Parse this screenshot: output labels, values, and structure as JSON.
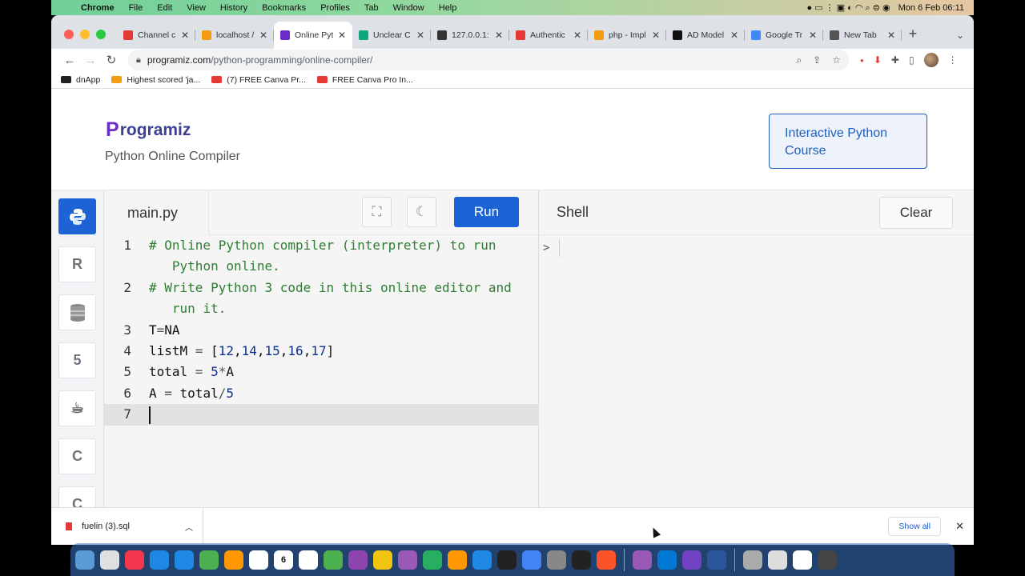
{
  "menubar": {
    "app": "Chrome",
    "items": [
      "File",
      "Edit",
      "View",
      "History",
      "Bookmarks",
      "Profiles",
      "Tab",
      "Window",
      "Help"
    ],
    "datetime": "Mon 6 Feb  06:11"
  },
  "tabs": [
    {
      "label": "Channel c",
      "color": "#e53935"
    },
    {
      "label": "localhost /",
      "color": "#f39c12"
    },
    {
      "label": "Online Pyt",
      "color": "#6c2dc7",
      "active": true
    },
    {
      "label": "Unclear C",
      "color": "#10a37f"
    },
    {
      "label": "127.0.0.1:",
      "color": "#333333"
    },
    {
      "label": "Authentic",
      "color": "#e53935"
    },
    {
      "label": "php - Impl",
      "color": "#f39c12"
    },
    {
      "label": "AD Model",
      "color": "#111111"
    },
    {
      "label": "Google Tr",
      "color": "#4285f4"
    },
    {
      "label": "New Tab",
      "color": "#555555"
    }
  ],
  "address": {
    "host": "programiz.com",
    "path": "/python-programming/online-compiler/"
  },
  "bookmarks": [
    {
      "label": "dnApp",
      "color": "#222222"
    },
    {
      "label": "Highest scored 'ja...",
      "color": "#f39c12"
    },
    {
      "label": "(7) FREE Canva Pr...",
      "color": "#e53935"
    },
    {
      "label": "FREE Canva Pro In...",
      "color": "#e53935"
    }
  ],
  "header": {
    "logo": "rogramiz",
    "logo_p": "P",
    "subtitle": "Python Online Compiler",
    "course_button": "Interactive Python Course"
  },
  "sidebar": [
    "python-icon",
    "r-icon",
    "sql-icon",
    "html5-icon",
    "java-icon",
    "c-icon",
    "cpp-icon"
  ],
  "editor": {
    "filename": "main.py",
    "run_label": "Run",
    "lines": [
      {
        "num": "1",
        "parts": [
          {
            "t": "# Online Python compiler (interpreter) to run\n   Python online.",
            "c": "c-com"
          }
        ]
      },
      {
        "num": "2",
        "parts": [
          {
            "t": "# Write Python 3 code in this online editor and\n   run it.",
            "c": "c-com"
          }
        ]
      },
      {
        "num": "3",
        "parts": [
          {
            "t": "T"
          },
          {
            "t": "=",
            "c": "c-op"
          },
          {
            "t": "NA"
          }
        ]
      },
      {
        "num": "4",
        "parts": [
          {
            "t": "listM "
          },
          {
            "t": "=",
            "c": "c-op"
          },
          {
            "t": " ["
          },
          {
            "t": "12",
            "c": "c-num"
          },
          {
            "t": ","
          },
          {
            "t": "14",
            "c": "c-num"
          },
          {
            "t": ","
          },
          {
            "t": "15",
            "c": "c-num"
          },
          {
            "t": ","
          },
          {
            "t": "16",
            "c": "c-num"
          },
          {
            "t": ","
          },
          {
            "t": "17",
            "c": "c-num"
          },
          {
            "t": "]"
          }
        ]
      },
      {
        "num": "5",
        "parts": [
          {
            "t": "total "
          },
          {
            "t": "=",
            "c": "c-op"
          },
          {
            "t": " "
          },
          {
            "t": "5",
            "c": "c-num"
          },
          {
            "t": "*",
            "c": "c-op"
          },
          {
            "t": "A"
          }
        ]
      },
      {
        "num": "6",
        "parts": [
          {
            "t": "A "
          },
          {
            "t": "=",
            "c": "c-op"
          },
          {
            "t": " total"
          },
          {
            "t": "/",
            "c": "c-op"
          },
          {
            "t": "5",
            "c": "c-num"
          }
        ]
      },
      {
        "num": "7",
        "parts": [],
        "active": true
      }
    ]
  },
  "shell": {
    "title": "Shell",
    "clear_label": "Clear",
    "prompt": ">"
  },
  "download": {
    "file": "fuelin (3).sql",
    "show_all": "Show all"
  },
  "dock": {
    "colors": [
      "#5b9bd5",
      "#e0e0e0",
      "#f4364c",
      "#1e88e5",
      "#1e88e5",
      "#4caf50",
      "#ff9800",
      "#ffffff",
      "#8d6e63",
      "#ffffff",
      "#4caf50",
      "#8e44ad",
      "#f1c40f",
      "#9b59b6",
      "#27ae60",
      "#ff9800",
      "#1e88e5",
      "#222222",
      "#4285f4",
      "#888888",
      "#222222",
      "#fb542b",
      "#9b59b6",
      "#0078d4",
      "#6f42c1",
      "#2b579a",
      "#aaaaaa",
      "#dddddd",
      "#ffffff",
      "#444444"
    ],
    "calendar_day": "6"
  }
}
